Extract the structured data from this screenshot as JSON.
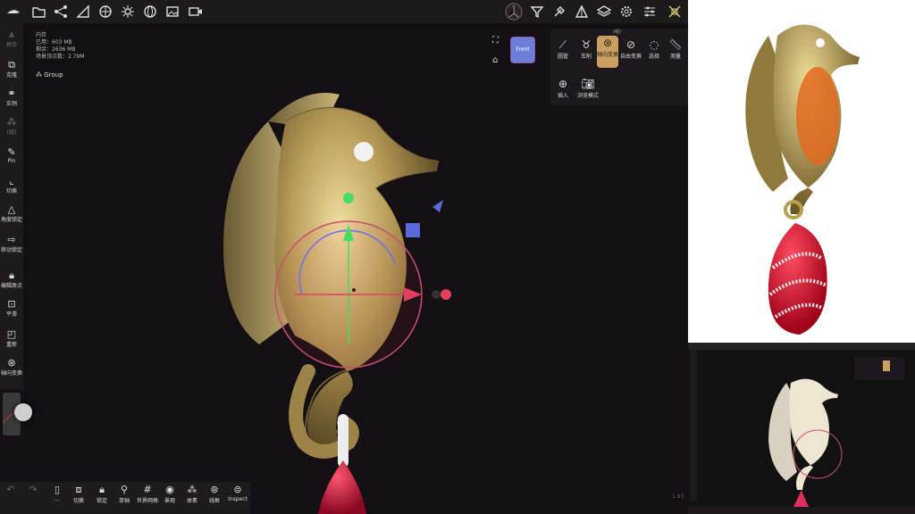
{
  "topbar": {
    "icons": [
      "brand-logo-icon",
      "folder-icon",
      "share-icon",
      "ruler-icon",
      "grid-icon",
      "sun-icon",
      "globe-icon",
      "image-icon",
      "video-icon"
    ],
    "right_icons": [
      "view-orb-icon",
      "filter-icon",
      "tool-icon",
      "triangle-icon",
      "layers-icon",
      "settings-icon",
      "sliders-icon",
      "transform-icon"
    ]
  },
  "left_toolbar": {
    "items": [
      {
        "label": "拼合",
        "icon": "triangle-stack-icon",
        "dim": true
      },
      {
        "label": "克隆",
        "icon": "clone-icon",
        "dim": false
      },
      {
        "label": "实例",
        "icon": "link-icon",
        "dim": false
      },
      {
        "label": "(组)",
        "icon": "group-icon",
        "dim": true
      },
      {
        "label": "Pin",
        "icon": "pin-icon",
        "dim": false
      },
      {
        "label": "切换",
        "icon": "switch-icon",
        "dim": false
      },
      {
        "label": "角度锁定",
        "icon": "angle-icon",
        "dim": false
      },
      {
        "label": "移动锁定",
        "icon": "move-icon",
        "dim": false
      },
      {
        "label": "编辑原点",
        "icon": "lock-icon",
        "dim": false
      },
      {
        "label": "平滑",
        "icon": "smooth-icon",
        "dim": false
      },
      {
        "label": "重新",
        "icon": "redo-box-icon",
        "dim": false
      },
      {
        "label": "轴向变换",
        "icon": "axis-transform-icon",
        "dim": false
      }
    ]
  },
  "info_panel": {
    "title": "内存",
    "used": "已用：603 MB",
    "free": "剩余：2636 MB",
    "vertices": "场景顶点数：2.79M"
  },
  "outliner": {
    "group_label": "Group"
  },
  "viewcube": {
    "label": "Front"
  },
  "right_toolbar": {
    "header": "(组)",
    "items": [
      {
        "label": "圆管",
        "icon": "tube-icon"
      },
      {
        "label": "车削",
        "icon": "lathe-icon"
      },
      {
        "label": "轴向变换",
        "icon": "axis-transform-icon",
        "active": true
      },
      {
        "label": "自由变换",
        "icon": "free-transform-icon"
      },
      {
        "label": "选择",
        "icon": "select-icon"
      },
      {
        "label": "测量",
        "icon": "measure-icon"
      },
      {
        "label": "插入",
        "icon": "insert-icon"
      },
      {
        "label": "浏览模式",
        "icon": "camera-icon"
      }
    ]
  },
  "bottom_toolbar": {
    "items": [
      {
        "label": "",
        "icon": "undo-icon",
        "dim": true
      },
      {
        "label": "",
        "icon": "redo-icon",
        "dim": true
      },
      {
        "label": "...",
        "icon": "phone-icon"
      },
      {
        "label": "切换",
        "icon": "image-swap-icon"
      },
      {
        "label": "锁定",
        "icon": "lock-icon"
      },
      {
        "label": "单轴",
        "icon": "search-icon"
      },
      {
        "label": "世界网格",
        "icon": "grid-icon"
      },
      {
        "label": "景观",
        "icon": "eye-icon"
      },
      {
        "label": "体素",
        "icon": "voxel-icon"
      },
      {
        "label": "线框",
        "icon": "wireframe-icon"
      },
      {
        "label": "Inspect",
        "icon": "inspect-icon"
      }
    ]
  },
  "status": {
    "fps": "1.93"
  },
  "colors": {
    "accent": "#caa060",
    "gizmo_x": "#e04060",
    "gizmo_y": "#44dd66",
    "gizmo_z": "#5a6ad8"
  }
}
